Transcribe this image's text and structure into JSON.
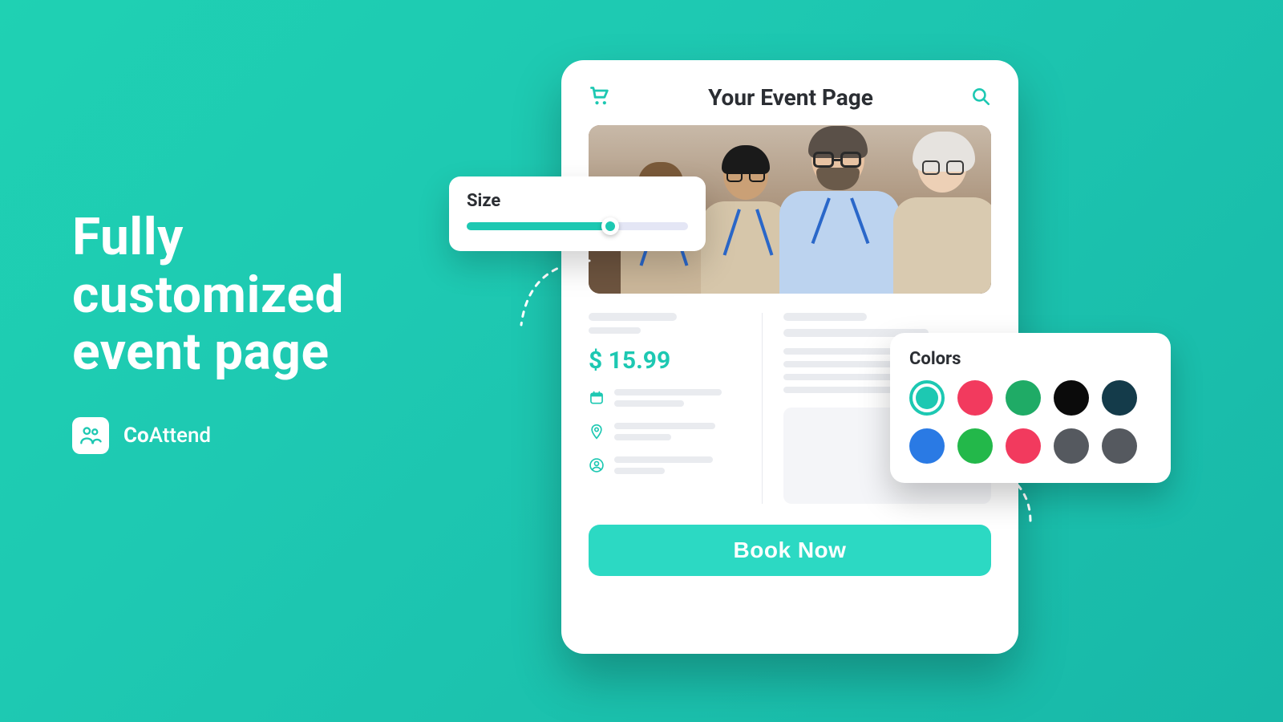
{
  "hero": {
    "line1": "Fully",
    "line2": "customized",
    "line3": "event page"
  },
  "brand": {
    "name_bold": "Co",
    "name_rest": "Attend"
  },
  "card": {
    "title": "Your Event Page",
    "price": "$ 15.99",
    "book_label": "Book Now"
  },
  "size_popover": {
    "title": "Size",
    "percent": 65
  },
  "colors_popover": {
    "title": "Colors",
    "swatches": [
      {
        "hex": "#1dc8b2",
        "selected": true
      },
      {
        "hex": "#f23a5e",
        "selected": false
      },
      {
        "hex": "#1fab66",
        "selected": false
      },
      {
        "hex": "#0b0b0b",
        "selected": false
      },
      {
        "hex": "#143b4a",
        "selected": false
      },
      {
        "hex": "#2a7ae4",
        "selected": false
      },
      {
        "hex": "#23b84a",
        "selected": false
      },
      {
        "hex": "#f23a5e",
        "selected": false
      },
      {
        "hex": "#55595f",
        "selected": false
      },
      {
        "hex": "#55595f",
        "selected": false
      }
    ]
  },
  "colors": {
    "accent": "#1dc8b2",
    "text": "#2b2e33",
    "placeholder": "#e9ebef"
  }
}
